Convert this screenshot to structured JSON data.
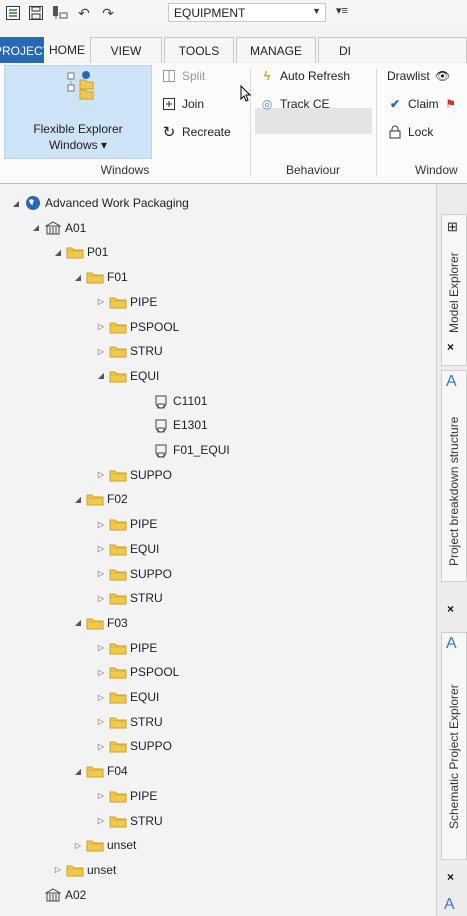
{
  "qat": {
    "context": "EQUIPMENT"
  },
  "tabs": [
    "PROJECT",
    "HOME",
    "VIEW",
    "TOOLS",
    "MANAGE",
    "DI"
  ],
  "ribbon": {
    "windows_group": {
      "big_button": [
        "Flexible Explorer",
        "Windows ▾"
      ],
      "split": "Split",
      "join": "Join",
      "recreate": "Recreate",
      "label": "Windows"
    },
    "behaviour_group": {
      "auto_refresh": "Auto Refresh",
      "track_ce": "Track CE",
      "label": "Behaviour"
    },
    "window_group": {
      "drawlist": "Drawlist",
      "claim": "Claim",
      "lock": "Lock",
      "label": "Window"
    }
  },
  "tree": [
    {
      "label": "Advanced Work Packaging",
      "level": 0,
      "icon": "world-icon",
      "state": "expanded"
    },
    {
      "label": "A01",
      "level": 1,
      "icon": "building-icon",
      "state": "expanded"
    },
    {
      "label": "P01",
      "level": 2,
      "icon": "folder-icon",
      "state": "expanded"
    },
    {
      "label": "F01",
      "level": 3,
      "icon": "folder-icon",
      "state": "expanded"
    },
    {
      "label": "PIPE",
      "level": 4,
      "icon": "folder-icon",
      "state": "collapsed"
    },
    {
      "label": "PSPOOL",
      "level": 4,
      "icon": "folder-icon",
      "state": "collapsed"
    },
    {
      "label": "STRU",
      "level": 4,
      "icon": "folder-icon",
      "state": "collapsed"
    },
    {
      "label": "EQUI",
      "level": 4,
      "icon": "folder-icon",
      "state": "expanded"
    },
    {
      "label": "C1101",
      "level": 5,
      "icon": "equipment-icon",
      "state": "leaf"
    },
    {
      "label": "E1301",
      "level": 5,
      "icon": "equipment-icon",
      "state": "leaf"
    },
    {
      "label": "F01_EQUI",
      "level": 5,
      "icon": "equipment-icon",
      "state": "leaf"
    },
    {
      "label": "SUPPO",
      "level": 4,
      "icon": "folder-icon",
      "state": "collapsed"
    },
    {
      "label": "F02",
      "level": 3,
      "icon": "folder-icon",
      "state": "expanded"
    },
    {
      "label": "PIPE",
      "level": 4,
      "icon": "folder-icon",
      "state": "collapsed"
    },
    {
      "label": "EQUI",
      "level": 4,
      "icon": "folder-icon",
      "state": "collapsed"
    },
    {
      "label": "SUPPO",
      "level": 4,
      "icon": "folder-icon",
      "state": "collapsed"
    },
    {
      "label": "STRU",
      "level": 4,
      "icon": "folder-icon",
      "state": "collapsed"
    },
    {
      "label": "F03",
      "level": 3,
      "icon": "folder-icon",
      "state": "expanded"
    },
    {
      "label": "PIPE",
      "level": 4,
      "icon": "folder-icon",
      "state": "collapsed"
    },
    {
      "label": "PSPOOL",
      "level": 4,
      "icon": "folder-icon",
      "state": "collapsed"
    },
    {
      "label": "EQUI",
      "level": 4,
      "icon": "folder-icon",
      "state": "collapsed"
    },
    {
      "label": "STRU",
      "level": 4,
      "icon": "folder-icon",
      "state": "collapsed"
    },
    {
      "label": "SUPPO",
      "level": 4,
      "icon": "folder-icon",
      "state": "collapsed"
    },
    {
      "label": "F04",
      "level": 3,
      "icon": "folder-icon",
      "state": "expanded"
    },
    {
      "label": "PIPE",
      "level": 4,
      "icon": "folder-icon",
      "state": "collapsed"
    },
    {
      "label": "STRU",
      "level": 4,
      "icon": "folder-icon",
      "state": "collapsed"
    },
    {
      "label": "unset",
      "level": 3,
      "icon": "folder-icon",
      "state": "collapsed"
    },
    {
      "label": "unset",
      "level": 2,
      "icon": "folder-icon",
      "state": "collapsed"
    },
    {
      "label": "A02",
      "level": 1,
      "icon": "building-icon",
      "state": "leaf"
    }
  ],
  "dock": {
    "model_explorer": "Model Explorer",
    "project_breakdown": "Project breakdown structure",
    "schematic_explorer": "Schematic Project Explorer",
    "close": "×"
  },
  "colors": {
    "accent": "#2a67b6",
    "folder": "#f2c94c",
    "selected": "#cfe3f6"
  }
}
